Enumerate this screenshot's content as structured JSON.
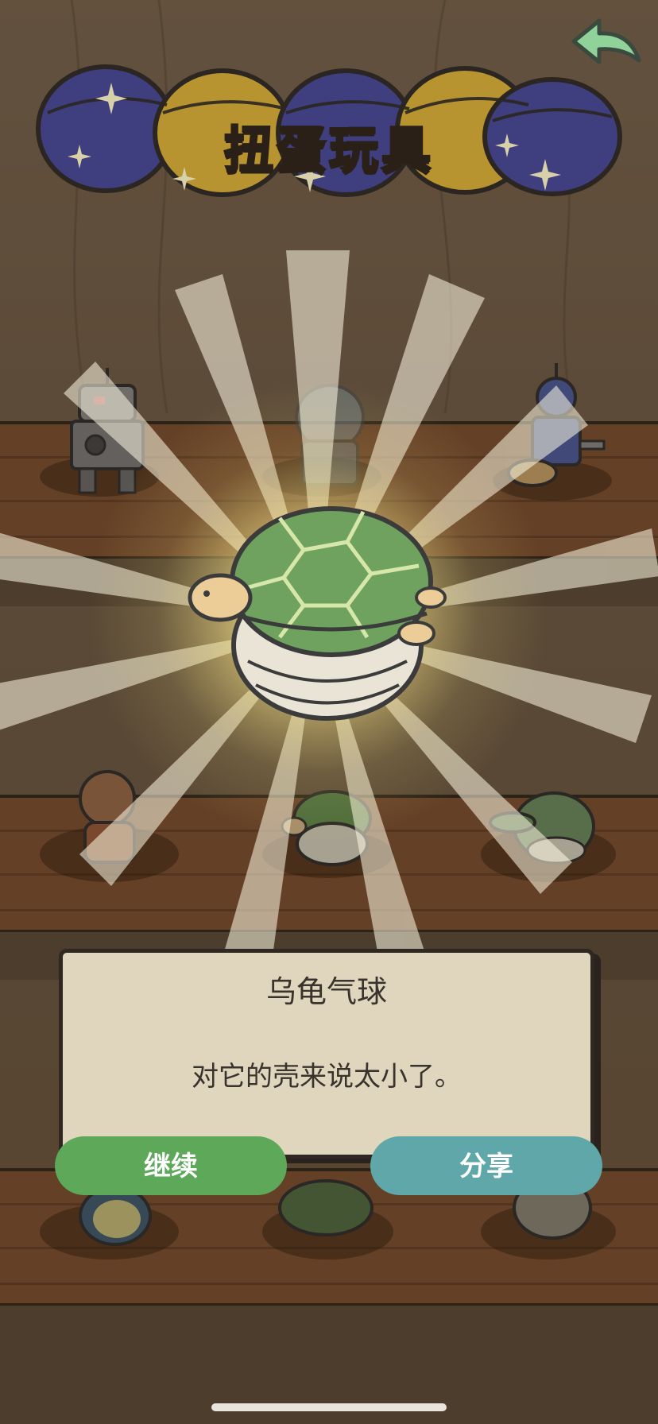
{
  "game": {
    "screen_title": "扭蛋玩具",
    "item_name": "乌龟气球",
    "item_description": "对它的壳来说太小了。",
    "buttons": {
      "continue_label": "继续",
      "share_label": "分享"
    }
  },
  "colors": {
    "continue_button": "#5ea85a",
    "share_button": "#5fa7a9",
    "dialog_bg": "#dfd6bd",
    "back_arrow": "#8fd39a",
    "capsule_blue": "#3f3f7f",
    "capsule_yellow": "#b89430"
  },
  "icons": {
    "back": "back-arrow-icon",
    "featured_item": "turtle-balloon-icon"
  },
  "shelves": {
    "row1": [
      "robot-toy",
      "robot-toy-ghost",
      "drummer-toy"
    ],
    "row2": [
      "diver-toy",
      "turtle-balloon-toy",
      "crocodile-toy"
    ],
    "row3": [
      "fish-toy",
      "frog-toy",
      "cat-toy"
    ]
  }
}
